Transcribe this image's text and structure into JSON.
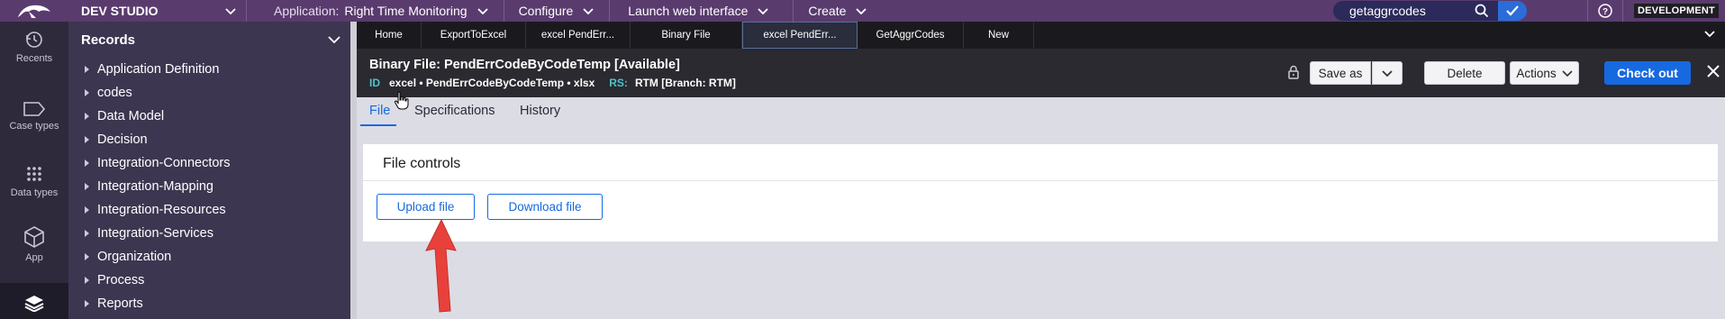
{
  "topbar": {
    "studio_label": "DEV STUDIO",
    "application_label": "Application:",
    "application_value": "Right Time Monitoring",
    "configure_label": "Configure",
    "launch_label": "Launch web interface",
    "create_label": "Create",
    "search_value": "getaggrcodes",
    "environment_badge": "DEVELOPMENT"
  },
  "rail": {
    "items": [
      {
        "label": "Recents",
        "icon": "history-icon"
      },
      {
        "label": "Case types",
        "icon": "case-type-icon"
      },
      {
        "label": "Data types",
        "icon": "data-grid-icon"
      },
      {
        "label": "App",
        "icon": "cube-icon"
      },
      {
        "label": "Records",
        "icon": "layers-icon"
      }
    ]
  },
  "records": {
    "title": "Records",
    "items": [
      {
        "label": "Application Definition"
      },
      {
        "label": "codes"
      },
      {
        "label": "Data Model"
      },
      {
        "label": "Decision"
      },
      {
        "label": "Integration-Connectors"
      },
      {
        "label": "Integration-Mapping"
      },
      {
        "label": "Integration-Resources"
      },
      {
        "label": "Integration-Services"
      },
      {
        "label": "Organization"
      },
      {
        "label": "Process"
      },
      {
        "label": "Reports"
      }
    ]
  },
  "tabs": [
    {
      "label": "Home"
    },
    {
      "label": "ExportToExcel"
    },
    {
      "label": "excel PendErr..."
    },
    {
      "label": "Binary File"
    },
    {
      "label": "excel PendErr..."
    },
    {
      "label": "GetAggrCodes"
    },
    {
      "label": "New"
    }
  ],
  "record": {
    "title": "Binary File: PendErrCodeByCodeTemp [Available]",
    "id_key": "ID",
    "id_value": "excel • PendErrCodeByCodeTemp • xlsx",
    "rs_key": "RS:",
    "rs_value": "RTM [Branch: RTM]",
    "save_as_label": "Save as",
    "delete_label": "Delete",
    "actions_label": "Actions",
    "checkout_label": "Check out"
  },
  "subtabs": [
    {
      "label": "File"
    },
    {
      "label": "Specifications"
    },
    {
      "label": "History"
    }
  ],
  "file_controls": {
    "title": "File controls",
    "upload_label": "Upload file",
    "download_label": "Download file"
  },
  "colors": {
    "topbar": "#5a3b6e",
    "primary": "#1769e0",
    "annotation_arrow": "#e8413c"
  }
}
